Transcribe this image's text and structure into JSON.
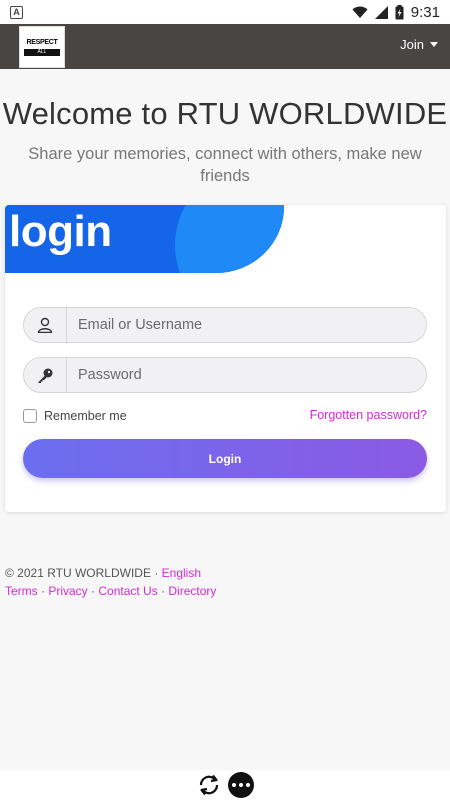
{
  "status_bar": {
    "time": "9:31",
    "app_badge": "A"
  },
  "navbar": {
    "logo_line1": "RESPECT",
    "logo_line2": "ALL",
    "join_label": "Join"
  },
  "hero": {
    "title": "Welcome to RTU WORLDWIDE",
    "subtitle": "Share your memories, connect with others, make new friends"
  },
  "login_card": {
    "banner_title": "login",
    "username_placeholder": "Email or Username",
    "password_placeholder": "Password",
    "remember_label": "Remember me",
    "forgot_label": "Forgotten password?",
    "submit_label": "Login"
  },
  "footer": {
    "copyright": "© 2021 RTU WORLDWIDE · ",
    "language": "English",
    "links": [
      "Terms",
      "Privacy",
      "Contact Us",
      "Directory"
    ],
    "separator": " · "
  },
  "colors": {
    "accent": "#d12bd8",
    "navbar": "#484542",
    "banner": "#1565e8",
    "button_start": "#6b6ef0",
    "button_end": "#8b5ae3"
  }
}
